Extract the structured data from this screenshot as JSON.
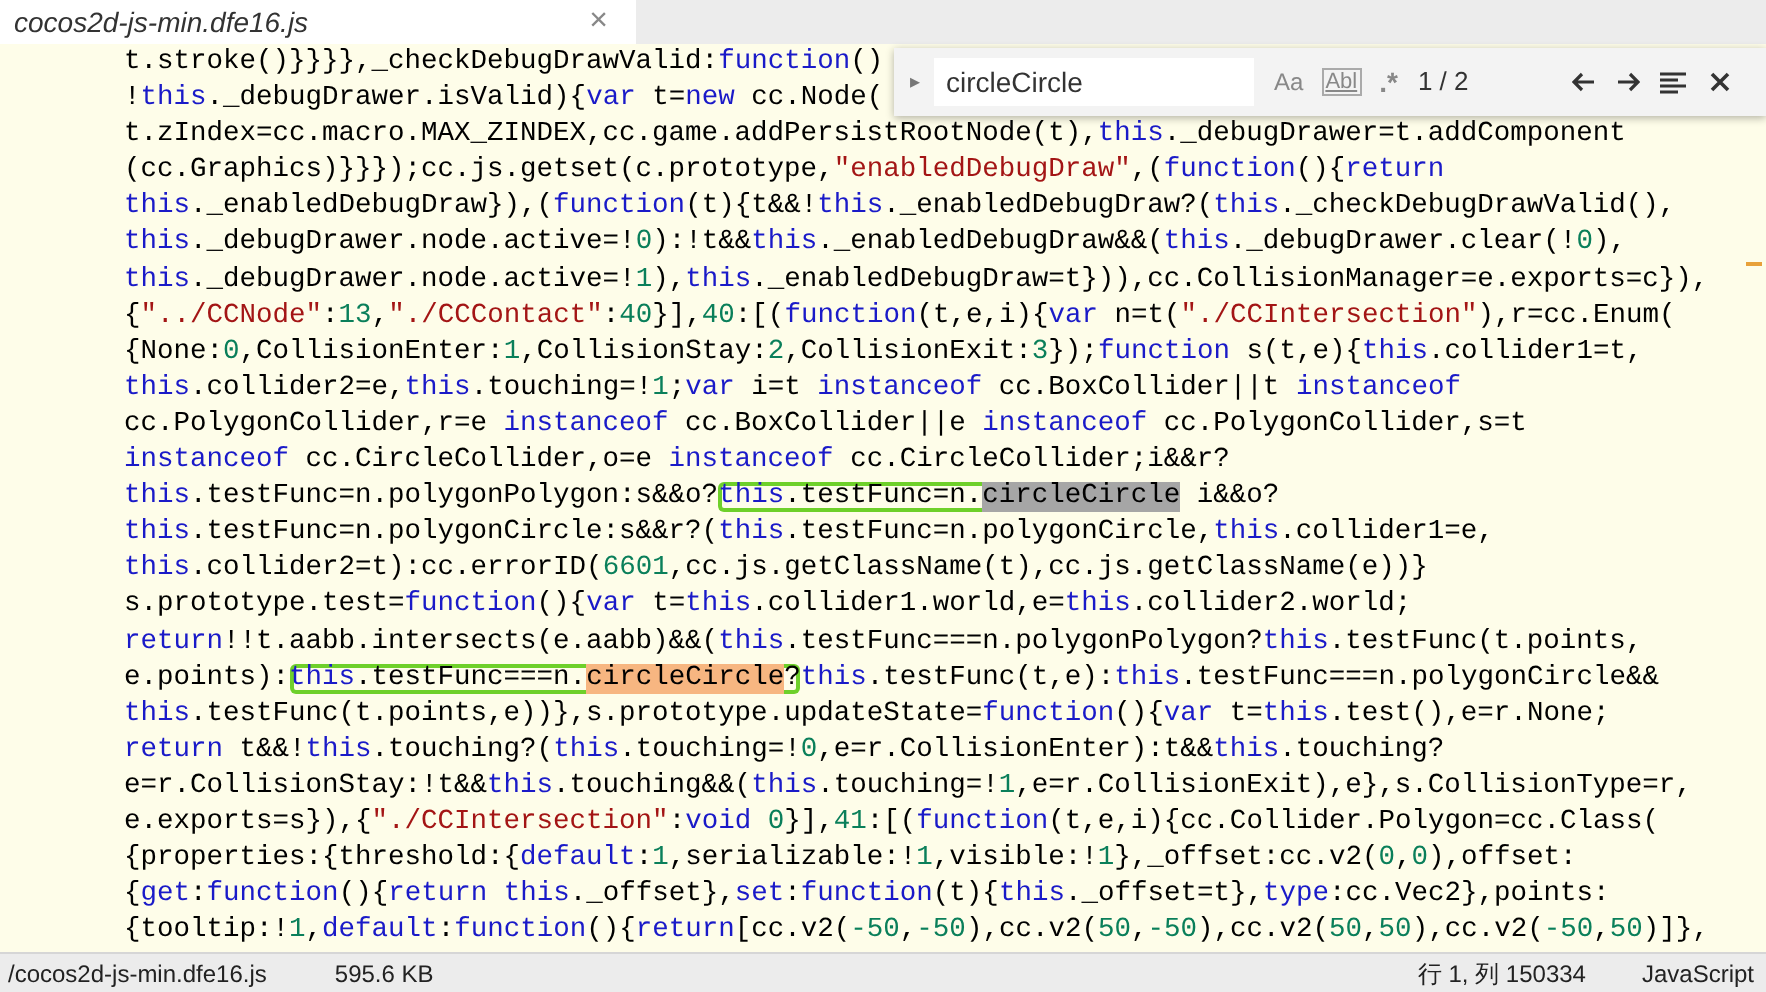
{
  "tab": {
    "title": "cocos2d-js-min.dfe16.js",
    "close": "×"
  },
  "search": {
    "toggle": "▸",
    "value": "circleCircle",
    "options": [
      {
        "kind": "case",
        "label": "Aa"
      },
      {
        "kind": "word",
        "label": "Abl"
      },
      {
        "kind": "regex",
        "label": ".*"
      }
    ],
    "count": "1 / 2"
  },
  "code_lines": [
    {
      "spans": [
        {
          "kind": "plain",
          "text": "t.stroke()}}}},_checkDebugDrawValid:"
        },
        {
          "kind": "kw",
          "text": "function"
        },
        {
          "kind": "plain",
          "text": "()"
        }
      ]
    },
    {
      "spans": [
        {
          "kind": "plain",
          "text": "!"
        },
        {
          "kind": "kw",
          "text": "this"
        },
        {
          "kind": "plain",
          "text": "._debugDrawer.isValid){"
        },
        {
          "kind": "kw",
          "text": "var"
        },
        {
          "kind": "plain",
          "text": " t="
        },
        {
          "kind": "kw",
          "text": "new"
        },
        {
          "kind": "plain",
          "text": " cc.Node("
        }
      ]
    },
    {
      "spans": [
        {
          "kind": "plain",
          "text": "t.zIndex=cc.macro.MAX_ZINDEX,cc.game.addPersistRootNode(t),"
        },
        {
          "kind": "kw",
          "text": "this"
        },
        {
          "kind": "plain",
          "text": "._debugDrawer=t.addComponent"
        }
      ]
    },
    {
      "spans": [
        {
          "kind": "plain",
          "text": "(cc.Graphics)}}});cc.js.getset(c.prototype,"
        },
        {
          "kind": "str",
          "text": "\"enabledDebugDraw\""
        },
        {
          "kind": "plain",
          "text": ",("
        },
        {
          "kind": "kw",
          "text": "function"
        },
        {
          "kind": "plain",
          "text": "(){"
        },
        {
          "kind": "kw",
          "text": "return"
        }
      ]
    },
    {
      "spans": [
        {
          "kind": "kw",
          "text": "this"
        },
        {
          "kind": "plain",
          "text": "._enabledDebugDraw}),("
        },
        {
          "kind": "kw",
          "text": "function"
        },
        {
          "kind": "plain",
          "text": "(t){t&&!"
        },
        {
          "kind": "kw",
          "text": "this"
        },
        {
          "kind": "plain",
          "text": "._enabledDebugDraw?("
        },
        {
          "kind": "kw",
          "text": "this"
        },
        {
          "kind": "plain",
          "text": "._checkDebugDrawValid(),"
        }
      ]
    },
    {
      "spans": [
        {
          "kind": "kw",
          "text": "this"
        },
        {
          "kind": "plain",
          "text": "._debugDrawer.node.active=!"
        },
        {
          "kind": "num",
          "text": "0"
        },
        {
          "kind": "plain",
          "text": "):!t&&"
        },
        {
          "kind": "kw",
          "text": "this"
        },
        {
          "kind": "plain",
          "text": "._enabledDebugDraw&&("
        },
        {
          "kind": "kw",
          "text": "this"
        },
        {
          "kind": "plain",
          "text": "._debugDrawer.clear(!"
        },
        {
          "kind": "num",
          "text": "0"
        },
        {
          "kind": "plain",
          "text": "),"
        }
      ]
    },
    {
      "spans": [
        {
          "kind": "kw",
          "text": "this"
        },
        {
          "kind": "plain",
          "text": "._debugDrawer.node.active=!"
        },
        {
          "kind": "num",
          "text": "1"
        },
        {
          "kind": "plain",
          "text": "),"
        },
        {
          "kind": "kw",
          "text": "this"
        },
        {
          "kind": "plain",
          "text": "._enabledDebugDraw=t})),cc.CollisionManager=e.exports=c}),"
        }
      ]
    },
    {
      "spans": [
        {
          "kind": "plain",
          "text": "{"
        },
        {
          "kind": "str",
          "text": "\"../CCNode\""
        },
        {
          "kind": "plain",
          "text": ":"
        },
        {
          "kind": "num",
          "text": "13"
        },
        {
          "kind": "plain",
          "text": ","
        },
        {
          "kind": "str",
          "text": "\"./CCContact\""
        },
        {
          "kind": "plain",
          "text": ":"
        },
        {
          "kind": "num",
          "text": "40"
        },
        {
          "kind": "plain",
          "text": "}],"
        },
        {
          "kind": "num",
          "text": "40"
        },
        {
          "kind": "plain",
          "text": ":[("
        },
        {
          "kind": "kw",
          "text": "function"
        },
        {
          "kind": "plain",
          "text": "(t,e,i){"
        },
        {
          "kind": "kw",
          "text": "var"
        },
        {
          "kind": "plain",
          "text": " n=t("
        },
        {
          "kind": "str",
          "text": "\"./CCIntersection\""
        },
        {
          "kind": "plain",
          "text": "),r=cc.Enum("
        }
      ]
    },
    {
      "spans": [
        {
          "kind": "plain",
          "text": "{None:"
        },
        {
          "kind": "num",
          "text": "0"
        },
        {
          "kind": "plain",
          "text": ",CollisionEnter:"
        },
        {
          "kind": "num",
          "text": "1"
        },
        {
          "kind": "plain",
          "text": ",CollisionStay:"
        },
        {
          "kind": "num",
          "text": "2"
        },
        {
          "kind": "plain",
          "text": ",CollisionExit:"
        },
        {
          "kind": "num",
          "text": "3"
        },
        {
          "kind": "plain",
          "text": "});"
        },
        {
          "kind": "kw",
          "text": "function"
        },
        {
          "kind": "plain",
          "text": " s(t,e){"
        },
        {
          "kind": "kw",
          "text": "this"
        },
        {
          "kind": "plain",
          "text": ".collider1=t,"
        }
      ]
    },
    {
      "spans": [
        {
          "kind": "kw",
          "text": "this"
        },
        {
          "kind": "plain",
          "text": ".collider2=e,"
        },
        {
          "kind": "kw",
          "text": "this"
        },
        {
          "kind": "plain",
          "text": ".touching=!"
        },
        {
          "kind": "num",
          "text": "1"
        },
        {
          "kind": "plain",
          "text": ";"
        },
        {
          "kind": "kw",
          "text": "var"
        },
        {
          "kind": "plain",
          "text": " i=t "
        },
        {
          "kind": "kw",
          "text": "instanceof"
        },
        {
          "kind": "plain",
          "text": " cc.BoxCollider||t "
        },
        {
          "kind": "kw",
          "text": "instanceof"
        }
      ]
    },
    {
      "spans": [
        {
          "kind": "plain",
          "text": "cc.PolygonCollider,r=e "
        },
        {
          "kind": "kw",
          "text": "instanceof"
        },
        {
          "kind": "plain",
          "text": " cc.BoxCollider||e "
        },
        {
          "kind": "kw",
          "text": "instanceof"
        },
        {
          "kind": "plain",
          "text": " cc.PolygonCollider,s=t"
        }
      ]
    },
    {
      "spans": [
        {
          "kind": "kw",
          "text": "instanceof"
        },
        {
          "kind": "plain",
          "text": " cc.CircleCollider,o=e "
        },
        {
          "kind": "kw",
          "text": "instanceof"
        },
        {
          "kind": "plain",
          "text": " cc.CircleCollider;i&&r?"
        }
      ]
    },
    {
      "spans": [
        {
          "kind": "kw",
          "text": "this"
        },
        {
          "kind": "plain",
          "text": ".testFunc=n.polygonPolygon:s&&o?"
        },
        {
          "kind": "outlined",
          "spans": [
            {
              "kind": "kw",
              "text": "this"
            },
            {
              "kind": "plain",
              "text": ".testFunc=n."
            },
            {
              "kind": "match",
              "text": "circleCircle",
              "selected": true
            }
          ]
        },
        {
          "kind": "plain",
          "text": " i&&o?"
        }
      ]
    },
    {
      "spans": [
        {
          "kind": "kw",
          "text": "this"
        },
        {
          "kind": "plain",
          "text": ".testFunc=n.polygonCircle:s&&r?("
        },
        {
          "kind": "kw",
          "text": "this"
        },
        {
          "kind": "plain",
          "text": ".testFunc=n.polygonCircle,"
        },
        {
          "kind": "kw",
          "text": "this"
        },
        {
          "kind": "plain",
          "text": ".collider1=e,"
        }
      ]
    },
    {
      "spans": [
        {
          "kind": "kw",
          "text": "this"
        },
        {
          "kind": "plain",
          "text": ".collider2=t):cc.errorID("
        },
        {
          "kind": "num",
          "text": "6601"
        },
        {
          "kind": "plain",
          "text": ",cc.js.getClassName(t),cc.js.getClassName(e))}"
        }
      ]
    },
    {
      "spans": [
        {
          "kind": "plain",
          "text": "s.prototype.test="
        },
        {
          "kind": "kw",
          "text": "function"
        },
        {
          "kind": "plain",
          "text": "(){"
        },
        {
          "kind": "kw",
          "text": "var"
        },
        {
          "kind": "plain",
          "text": " t="
        },
        {
          "kind": "kw",
          "text": "this"
        },
        {
          "kind": "plain",
          "text": ".collider1.world,e="
        },
        {
          "kind": "kw",
          "text": "this"
        },
        {
          "kind": "plain",
          "text": ".collider2.world;"
        }
      ]
    },
    {
      "spans": [
        {
          "kind": "kw",
          "text": "return"
        },
        {
          "kind": "plain",
          "text": "!!t.aabb.intersects(e.aabb)&&("
        },
        {
          "kind": "kw",
          "text": "this"
        },
        {
          "kind": "plain",
          "text": ".testFunc===n.polygonPolygon?"
        },
        {
          "kind": "kw",
          "text": "this"
        },
        {
          "kind": "plain",
          "text": ".testFunc(t.points,"
        }
      ]
    },
    {
      "spans": [
        {
          "kind": "plain",
          "text": "e.points):"
        },
        {
          "kind": "outlined",
          "spans": [
            {
              "kind": "kw",
              "text": "this"
            },
            {
              "kind": "plain",
              "text": ".testFunc===n."
            },
            {
              "kind": "match",
              "text": "circleCircle",
              "selected": false
            },
            {
              "kind": "plain",
              "text": "?"
            }
          ]
        },
        {
          "kind": "kw",
          "text": "this"
        },
        {
          "kind": "plain",
          "text": ".testFunc(t,e):"
        },
        {
          "kind": "kw",
          "text": "this"
        },
        {
          "kind": "plain",
          "text": ".testFunc===n.polygonCircle&&"
        }
      ]
    },
    {
      "spans": [
        {
          "kind": "kw",
          "text": "this"
        },
        {
          "kind": "plain",
          "text": ".testFunc(t.points,e))},s.prototype.updateState="
        },
        {
          "kind": "kw",
          "text": "function"
        },
        {
          "kind": "plain",
          "text": "(){"
        },
        {
          "kind": "kw",
          "text": "var"
        },
        {
          "kind": "plain",
          "text": " t="
        },
        {
          "kind": "kw",
          "text": "this"
        },
        {
          "kind": "plain",
          "text": ".test(),e=r.None;"
        }
      ]
    },
    {
      "spans": [
        {
          "kind": "kw",
          "text": "return"
        },
        {
          "kind": "plain",
          "text": " t&&!"
        },
        {
          "kind": "kw",
          "text": "this"
        },
        {
          "kind": "plain",
          "text": ".touching?("
        },
        {
          "kind": "kw",
          "text": "this"
        },
        {
          "kind": "plain",
          "text": ".touching=!"
        },
        {
          "kind": "num",
          "text": "0"
        },
        {
          "kind": "plain",
          "text": ",e=r.CollisionEnter):t&&"
        },
        {
          "kind": "kw",
          "text": "this"
        },
        {
          "kind": "plain",
          "text": ".touching?"
        }
      ]
    },
    {
      "spans": [
        {
          "kind": "plain",
          "text": "e=r.CollisionStay:!t&&"
        },
        {
          "kind": "kw",
          "text": "this"
        },
        {
          "kind": "plain",
          "text": ".touching&&("
        },
        {
          "kind": "kw",
          "text": "this"
        },
        {
          "kind": "plain",
          "text": ".touching=!"
        },
        {
          "kind": "num",
          "text": "1"
        },
        {
          "kind": "plain",
          "text": ",e=r.CollisionExit),e},s.CollisionType=r,"
        }
      ]
    },
    {
      "spans": [
        {
          "kind": "plain",
          "text": "e.exports=s}),{"
        },
        {
          "kind": "str",
          "text": "\"./CCIntersection\""
        },
        {
          "kind": "plain",
          "text": ":"
        },
        {
          "kind": "kw",
          "text": "void "
        },
        {
          "kind": "num",
          "text": "0"
        },
        {
          "kind": "plain",
          "text": "}],"
        },
        {
          "kind": "num",
          "text": "41"
        },
        {
          "kind": "plain",
          "text": ":[("
        },
        {
          "kind": "kw",
          "text": "function"
        },
        {
          "kind": "plain",
          "text": "(t,e,i){cc.Collider.Polygon=cc.Class("
        }
      ]
    },
    {
      "spans": [
        {
          "kind": "plain",
          "text": "{properties:{threshold:{"
        },
        {
          "kind": "kw",
          "text": "default"
        },
        {
          "kind": "plain",
          "text": ":"
        },
        {
          "kind": "num",
          "text": "1"
        },
        {
          "kind": "plain",
          "text": ",serializable:!"
        },
        {
          "kind": "num",
          "text": "1"
        },
        {
          "kind": "plain",
          "text": ",visible:!"
        },
        {
          "kind": "num",
          "text": "1"
        },
        {
          "kind": "plain",
          "text": "},_offset:cc.v2("
        },
        {
          "kind": "num",
          "text": "0"
        },
        {
          "kind": "plain",
          "text": ","
        },
        {
          "kind": "num",
          "text": "0"
        },
        {
          "kind": "plain",
          "text": "),offset:"
        }
      ]
    },
    {
      "spans": [
        {
          "kind": "plain",
          "text": "{"
        },
        {
          "kind": "kw",
          "text": "get"
        },
        {
          "kind": "plain",
          "text": ":"
        },
        {
          "kind": "kw",
          "text": "function"
        },
        {
          "kind": "plain",
          "text": "(){"
        },
        {
          "kind": "kw",
          "text": "return "
        },
        {
          "kind": "kw",
          "text": "this"
        },
        {
          "kind": "plain",
          "text": "._offset},"
        },
        {
          "kind": "kw",
          "text": "set"
        },
        {
          "kind": "plain",
          "text": ":"
        },
        {
          "kind": "kw",
          "text": "function"
        },
        {
          "kind": "plain",
          "text": "(t){"
        },
        {
          "kind": "kw",
          "text": "this"
        },
        {
          "kind": "plain",
          "text": "._offset=t},"
        },
        {
          "kind": "kw",
          "text": "type"
        },
        {
          "kind": "plain",
          "text": ":cc.Vec2},points:"
        }
      ]
    },
    {
      "spans": [
        {
          "kind": "plain",
          "text": "{tooltip:!"
        },
        {
          "kind": "num",
          "text": "1"
        },
        {
          "kind": "plain",
          "text": ","
        },
        {
          "kind": "kw",
          "text": "default"
        },
        {
          "kind": "plain",
          "text": ":"
        },
        {
          "kind": "kw",
          "text": "function"
        },
        {
          "kind": "plain",
          "text": "(){"
        },
        {
          "kind": "kw",
          "text": "return"
        },
        {
          "kind": "plain",
          "text": "[cc.v2("
        },
        {
          "kind": "num",
          "text": "-50"
        },
        {
          "kind": "plain",
          "text": ","
        },
        {
          "kind": "num",
          "text": "-50"
        },
        {
          "kind": "plain",
          "text": "),cc.v2("
        },
        {
          "kind": "num",
          "text": "50"
        },
        {
          "kind": "plain",
          "text": ","
        },
        {
          "kind": "num",
          "text": "-50"
        },
        {
          "kind": "plain",
          "text": "),cc.v2("
        },
        {
          "kind": "num",
          "text": "50"
        },
        {
          "kind": "plain",
          "text": ","
        },
        {
          "kind": "num",
          "text": "50"
        },
        {
          "kind": "plain",
          "text": "),cc.v2("
        },
        {
          "kind": "num",
          "text": "-50"
        },
        {
          "kind": "plain",
          "text": ","
        },
        {
          "kind": "num",
          "text": "50"
        },
        {
          "kind": "plain",
          "text": ")]},"
        }
      ]
    }
  ],
  "status_bar": {
    "path": "/cocos2d-js-min.dfe16.js",
    "size": "595.6 KB",
    "position": "行 1, 列 150334",
    "language": "JavaScript"
  }
}
